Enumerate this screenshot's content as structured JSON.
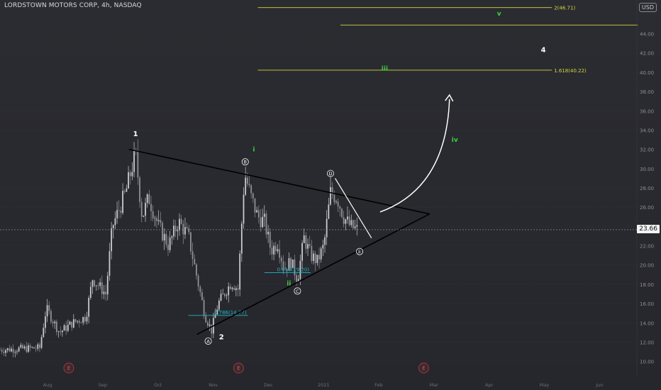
{
  "header": {
    "title": "LORDSTOWN MOTORS CORP, 4h, NASDAQ",
    "currency": "USD"
  },
  "colors": {
    "background": "#26272c",
    "candle": "#b9bac0",
    "trendline": "#000000",
    "arrow": "#ffffff",
    "fib_yellow": "#d4d63c",
    "fib_cyan": "#1fb7c5",
    "wave_green": "#3bd33b",
    "earnings_red": "#b0353a"
  },
  "chart_data": {
    "type": "candlestick",
    "y_axis": {
      "ticks": [
        "44.00",
        "42.00",
        "40.00",
        "38.00",
        "36.00",
        "34.00",
        "32.00",
        "30.00",
        "28.00",
        "26.00",
        "24.00",
        "22.00",
        "20.00",
        "18.00",
        "16.00",
        "14.00",
        "12.00",
        "10.00"
      ],
      "ylim": [
        8.5,
        47.5
      ]
    },
    "x_axis": {
      "ticks": [
        "Aug",
        "Sep",
        "Oct",
        "Nov",
        "Dec",
        "2021",
        "Feb",
        "Mar",
        "Apr",
        "May",
        "Jun"
      ]
    },
    "current_price": "23.66",
    "price_path": [
      [
        0,
        11.2
      ],
      [
        0.06,
        11.4
      ],
      [
        0.07,
        15.5
      ],
      [
        0.09,
        13.0
      ],
      [
        0.11,
        14.0
      ],
      [
        0.13,
        14.6
      ],
      [
        0.14,
        18.6
      ],
      [
        0.16,
        17.0
      ],
      [
        0.17,
        24.0
      ],
      [
        0.19,
        27.5
      ],
      [
        0.205,
        31.6
      ],
      [
        0.215,
        25.0
      ],
      [
        0.225,
        27.0
      ],
      [
        0.24,
        24.0
      ],
      [
        0.255,
        22.0
      ],
      [
        0.27,
        24.5
      ],
      [
        0.285,
        23.0
      ],
      [
        0.3,
        18.0
      ],
      [
        0.31,
        14.8
      ],
      [
        0.32,
        13.2
      ],
      [
        0.33,
        16.0
      ],
      [
        0.35,
        18.2
      ],
      [
        0.36,
        17.5
      ],
      [
        0.37,
        29.5
      ],
      [
        0.38,
        27.0
      ],
      [
        0.39,
        25.0
      ],
      [
        0.4,
        24.5
      ],
      [
        0.41,
        21.5
      ],
      [
        0.42,
        22.3
      ],
      [
        0.43,
        19.6
      ],
      [
        0.44,
        20.4
      ],
      [
        0.45,
        18.5
      ],
      [
        0.46,
        22.8
      ],
      [
        0.47,
        21.0
      ],
      [
        0.48,
        20.4
      ],
      [
        0.49,
        22.0
      ],
      [
        0.5,
        27.5
      ],
      [
        0.51,
        27.0
      ],
      [
        0.52,
        25.0
      ],
      [
        0.53,
        24.0
      ],
      [
        0.54,
        23.66
      ]
    ],
    "trendlines": [
      {
        "name": "upper",
        "from": [
          0.195,
          32.0
        ],
        "to": [
          0.65,
          25.3
        ]
      },
      {
        "name": "lower",
        "from": [
          0.298,
          12.8
        ],
        "to": [
          0.65,
          25.3
        ]
      },
      {
        "name": "wave-d-to-e",
        "from": [
          0.507,
          29.0
        ],
        "to": [
          0.562,
          22.8
        ]
      }
    ],
    "projection_arrow": {
      "from": [
        0.575,
        25.5
      ],
      "ctrl": [
        0.675,
        28.0
      ],
      "to": [
        0.68,
        37.5
      ]
    },
    "fib_levels": [
      {
        "label": "1.618(40.22)",
        "value": 40.22,
        "x0": 0.39,
        "x1": 0.835,
        "color": "yellow"
      },
      {
        "label": "2(46.71)",
        "value": 46.71,
        "x0": 0.39,
        "x1": 0.835,
        "color": "yellow"
      },
      {
        "label": "",
        "value": 44.9,
        "x0": 0.515,
        "x1": 0.965,
        "color": "yellow"
      },
      {
        "label": "0.618(19.20)",
        "value": 19.2,
        "x0": 0.4,
        "x1": 0.47,
        "color": "cyan"
      },
      {
        "label": "0.786(14.77)",
        "value": 14.77,
        "x0": 0.285,
        "x1": 0.375,
        "color": "cyan"
      }
    ],
    "wave_labels": [
      {
        "text": "1",
        "x": 0.205,
        "y": 33.6,
        "color": "white",
        "style": "plain"
      },
      {
        "text": "2",
        "x": 0.335,
        "y": 12.5,
        "color": "white",
        "style": "plain"
      },
      {
        "text": "4",
        "x": 0.822,
        "y": 42.3,
        "color": "white",
        "style": "plain"
      },
      {
        "text": "i",
        "x": 0.384,
        "y": 32.0,
        "color": "green",
        "style": "plain"
      },
      {
        "text": "ii",
        "x": 0.437,
        "y": 18.1,
        "color": "green",
        "style": "plain"
      },
      {
        "text": "iii",
        "x": 0.582,
        "y": 40.4,
        "color": "green",
        "style": "plain"
      },
      {
        "text": "iv",
        "x": 0.688,
        "y": 33.0,
        "color": "green",
        "style": "plain"
      },
      {
        "text": "v",
        "x": 0.755,
        "y": 46.1,
        "color": "green",
        "style": "plain"
      },
      {
        "text": "A",
        "x": 0.315,
        "y": 12.1,
        "color": "white",
        "style": "circle"
      },
      {
        "text": "B",
        "x": 0.371,
        "y": 30.7,
        "color": "white",
        "style": "circle"
      },
      {
        "text": "C",
        "x": 0.45,
        "y": 17.3,
        "color": "white",
        "style": "circle"
      },
      {
        "text": "D",
        "x": 0.5,
        "y": 29.5,
        "color": "white",
        "style": "circle"
      },
      {
        "text": "E",
        "x": 0.544,
        "y": 21.4,
        "color": "white",
        "style": "circle"
      }
    ],
    "earnings_markers": [
      {
        "text": "E",
        "x": 0.104
      },
      {
        "text": "E",
        "x": 0.361
      },
      {
        "text": "E",
        "x": 0.641
      }
    ]
  }
}
